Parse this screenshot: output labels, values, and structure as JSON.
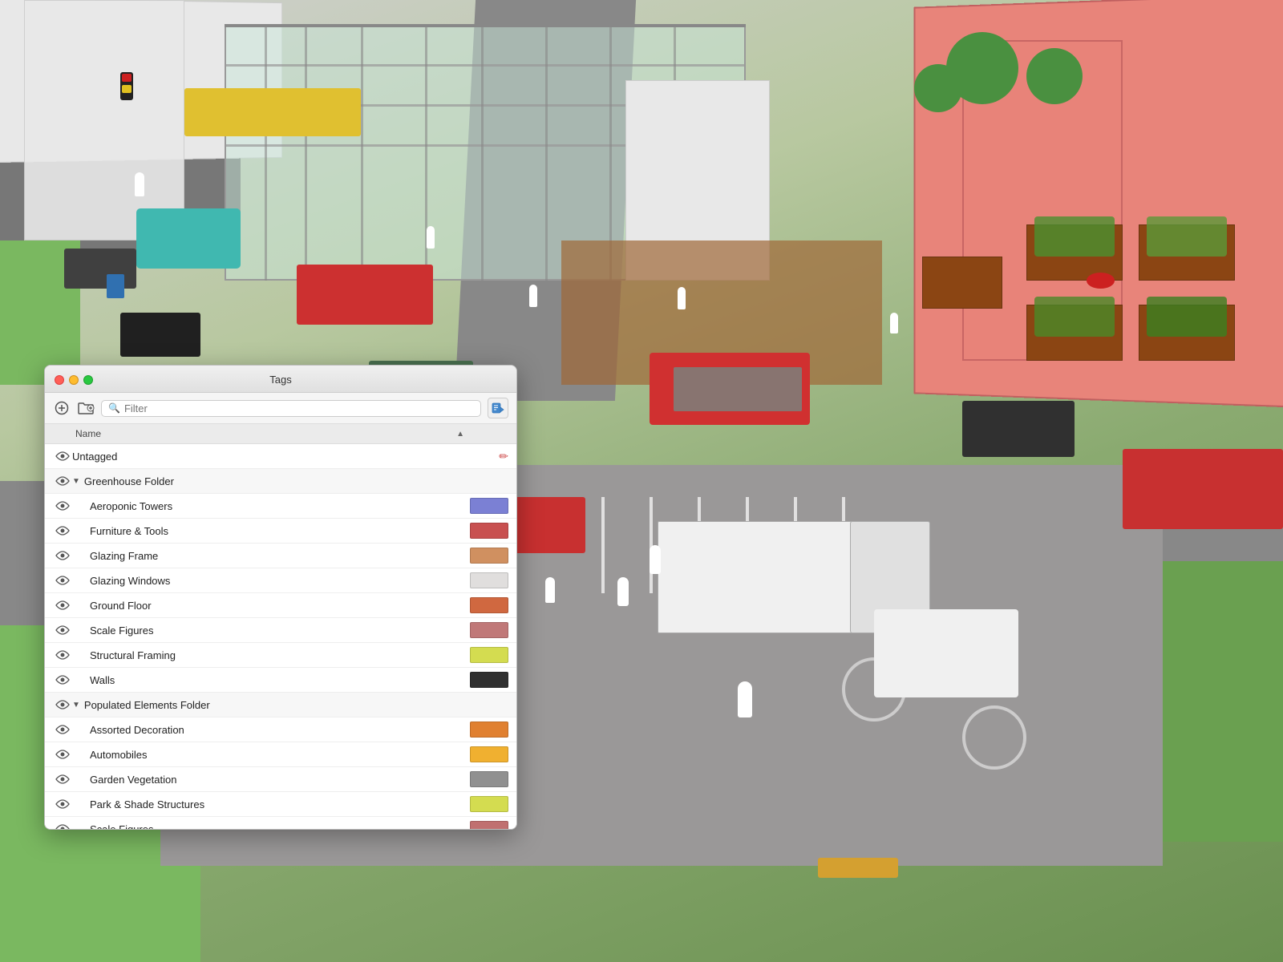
{
  "panel": {
    "title": "Tags",
    "filter_placeholder": "Filter",
    "toolbar": {
      "add_label": "+",
      "folder_label": "⊞",
      "export_label": "▶"
    },
    "columns": {
      "name_label": "Name",
      "sort_icon": "▲"
    },
    "rows": [
      {
        "id": "untagged",
        "indent": 0,
        "is_folder": false,
        "name": "Untagged",
        "color": null,
        "has_pencil": true,
        "pencil_label": "✏"
      },
      {
        "id": "greenhouse-folder",
        "indent": 0,
        "is_folder": true,
        "name": "Greenhouse Folder",
        "color": null,
        "expanded": true
      },
      {
        "id": "aeroponic-towers",
        "indent": 1,
        "is_folder": false,
        "name": "Aeroponic Towers",
        "color": "#7b80d4"
      },
      {
        "id": "furniture-tools",
        "indent": 1,
        "is_folder": false,
        "name": "Furniture & Tools",
        "color": "#c85050"
      },
      {
        "id": "glazing-frame",
        "indent": 1,
        "is_folder": false,
        "name": "Glazing Frame",
        "color": "#d09060"
      },
      {
        "id": "glazing-windows",
        "indent": 1,
        "is_folder": false,
        "name": "Glazing Windows",
        "color": "#e0dedd"
      },
      {
        "id": "ground-floor",
        "indent": 1,
        "is_folder": false,
        "name": "Ground Floor",
        "color": "#d06840"
      },
      {
        "id": "scale-figures-gh",
        "indent": 1,
        "is_folder": false,
        "name": "Scale Figures",
        "color": "#c07878"
      },
      {
        "id": "structural-framing",
        "indent": 1,
        "is_folder": false,
        "name": "Structural Framing",
        "color": "#d4dc50"
      },
      {
        "id": "walls",
        "indent": 1,
        "is_folder": false,
        "name": "Walls",
        "color": "#303030"
      },
      {
        "id": "populated-elements-folder",
        "indent": 0,
        "is_folder": true,
        "name": "Populated Elements Folder",
        "color": null,
        "expanded": true
      },
      {
        "id": "assorted-decoration",
        "indent": 1,
        "is_folder": false,
        "name": "Assorted Decoration",
        "color": "#e08030"
      },
      {
        "id": "automobiles",
        "indent": 1,
        "is_folder": false,
        "name": "Automobiles",
        "color": "#f0b030"
      },
      {
        "id": "garden-vegetation",
        "indent": 1,
        "is_folder": false,
        "name": "Garden Vegetation",
        "color": "#909090"
      },
      {
        "id": "park-shade-structures",
        "indent": 1,
        "is_folder": false,
        "name": "Park & Shade Structures",
        "color": "#d4dc50"
      },
      {
        "id": "scale-figures-pe",
        "indent": 1,
        "is_folder": false,
        "name": "Scale Figures",
        "color": "#c07070"
      }
    ]
  },
  "scene": {
    "description": "3D architectural visualization of urban greenhouse and parking area"
  }
}
